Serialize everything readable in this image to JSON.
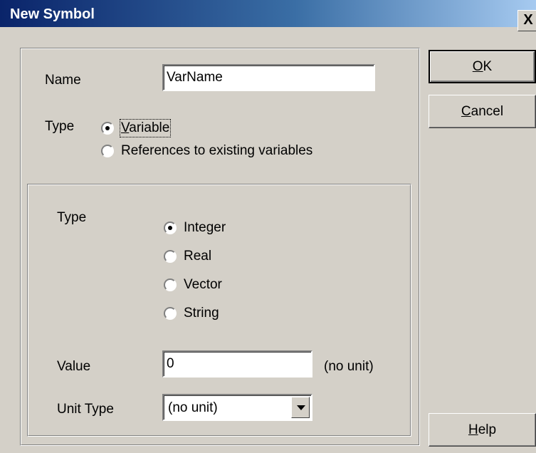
{
  "window": {
    "title": "New Symbol",
    "close_glyph": "X"
  },
  "form": {
    "name_label": "Name",
    "name_value": "VarName",
    "kind_label": "Type",
    "kind_options": [
      {
        "label": "Variable",
        "selected": true
      },
      {
        "label": "References to existing variables",
        "selected": false
      }
    ]
  },
  "details": {
    "type_label": "Type",
    "type_options": [
      {
        "label": "Integer",
        "selected": true
      },
      {
        "label": "Real",
        "selected": false
      },
      {
        "label": "Vector",
        "selected": false
      },
      {
        "label": "String",
        "selected": false
      }
    ],
    "value_label": "Value",
    "value": "0",
    "value_unit": "(no unit)",
    "unit_type_label": "Unit Type",
    "unit_type_selected": "(no unit)"
  },
  "buttons": {
    "ok_label": "OK",
    "cancel_label": "Cancel",
    "help_label": "Help"
  }
}
